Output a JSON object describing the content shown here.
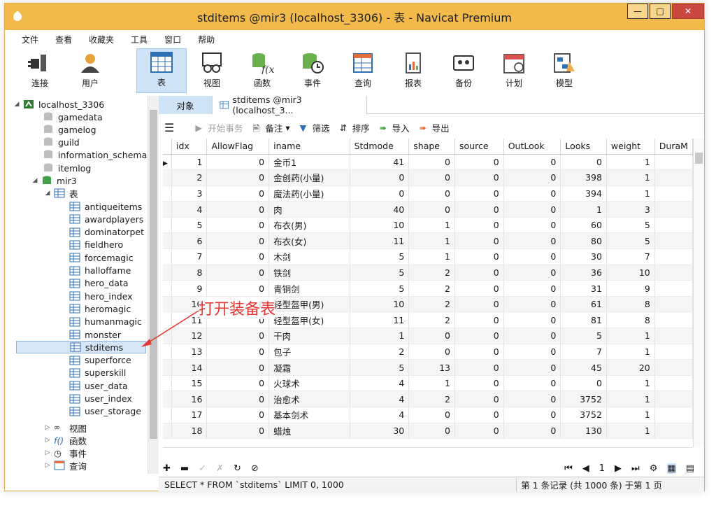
{
  "window": {
    "title": "stditems @mir3 (localhost_3306) - 表 - Navicat Premium"
  },
  "menu": [
    "文件",
    "查看",
    "收藏夹",
    "工具",
    "窗口",
    "帮助"
  ],
  "toolbar": [
    {
      "label": "连接",
      "icon": "plug-icon"
    },
    {
      "label": "用户",
      "icon": "user-icon"
    },
    {
      "label": "表",
      "icon": "table-icon",
      "active": true
    },
    {
      "label": "视图",
      "icon": "glasses-icon"
    },
    {
      "label": "函数",
      "icon": "function-icon"
    },
    {
      "label": "事件",
      "icon": "clock-db-icon"
    },
    {
      "label": "查询",
      "icon": "query-icon"
    },
    {
      "label": "报表",
      "icon": "report-icon"
    },
    {
      "label": "备份",
      "icon": "backup-icon"
    },
    {
      "label": "计划",
      "icon": "calendar-icon"
    },
    {
      "label": "模型",
      "icon": "model-icon"
    }
  ],
  "tree": {
    "connection": "localhost_3306",
    "databases": [
      "gamedata",
      "gamelog",
      "guild",
      "information_schema",
      "itemlog",
      "mir3"
    ],
    "tables_label": "表",
    "tables": [
      "antiqueitems",
      "awardplayers",
      "dominatorpet",
      "fieldhero",
      "forcemagic",
      "halloffame",
      "hero_data",
      "hero_index",
      "heromagic",
      "humanmagic",
      "monster",
      "stditems",
      "superforce",
      "superskill",
      "user_data",
      "user_index",
      "user_storage"
    ],
    "selected": "stditems",
    "other_nodes": [
      "视图",
      "函数",
      "事件",
      "查询"
    ]
  },
  "tabs": {
    "objects": "对象",
    "data": "stditems @mir3 (localhost_3..."
  },
  "grid_toolbar": {
    "begin_tx": "开始事务",
    "note": "备注",
    "filter": "筛选",
    "sort": "排序",
    "import": "导入",
    "export": "导出"
  },
  "grid": {
    "columns": [
      "idx",
      "AllowFlag",
      "iname",
      "Stdmode",
      "shape",
      "source",
      "OutLook",
      "Looks",
      "weight",
      "DuraM"
    ],
    "rows": [
      [
        "1",
        "0",
        "金币1",
        "41",
        "0",
        "0",
        "0",
        "0",
        "1"
      ],
      [
        "2",
        "0",
        "金创药(小量)",
        "0",
        "0",
        "0",
        "0",
        "398",
        "1"
      ],
      [
        "3",
        "0",
        "魔法药(小量)",
        "0",
        "0",
        "0",
        "0",
        "394",
        "1"
      ],
      [
        "4",
        "0",
        "肉",
        "40",
        "0",
        "0",
        "0",
        "1",
        "3"
      ],
      [
        "5",
        "0",
        "布衣(男)",
        "10",
        "1",
        "0",
        "0",
        "60",
        "5"
      ],
      [
        "6",
        "0",
        "布衣(女)",
        "11",
        "1",
        "0",
        "0",
        "80",
        "5"
      ],
      [
        "7",
        "0",
        "木剑",
        "5",
        "1",
        "0",
        "0",
        "30",
        "7"
      ],
      [
        "8",
        "0",
        "铁剑",
        "5",
        "2",
        "0",
        "0",
        "36",
        "10"
      ],
      [
        "9",
        "0",
        "青铜剑",
        "5",
        "2",
        "0",
        "0",
        "31",
        "9"
      ],
      [
        "10",
        "0",
        "轻型盔甲(男)",
        "10",
        "2",
        "0",
        "0",
        "61",
        "8"
      ],
      [
        "11",
        "0",
        "轻型盔甲(女)",
        "11",
        "2",
        "0",
        "0",
        "81",
        "8"
      ],
      [
        "12",
        "0",
        "干肉",
        "1",
        "0",
        "0",
        "0",
        "5",
        "1"
      ],
      [
        "13",
        "0",
        "包子",
        "2",
        "0",
        "0",
        "0",
        "7",
        "1"
      ],
      [
        "14",
        "0",
        "凝霜",
        "5",
        "13",
        "0",
        "0",
        "45",
        "20"
      ],
      [
        "15",
        "0",
        "火球术",
        "4",
        "1",
        "0",
        "0",
        "0",
        "1"
      ],
      [
        "16",
        "0",
        "治愈术",
        "4",
        "2",
        "0",
        "0",
        "3752",
        "1"
      ],
      [
        "17",
        "0",
        "基本剑术",
        "4",
        "0",
        "0",
        "0",
        "3752",
        "1"
      ],
      [
        "18",
        "0",
        "蜡烛",
        "30",
        "0",
        "0",
        "0",
        "130",
        "1"
      ]
    ]
  },
  "navigator": {
    "page": "1"
  },
  "status": {
    "sql": "SELECT * FROM `stditems` LIMIT 0, 1000",
    "records": "第 1 条记录 (共 1000 条) 于第 1 页"
  },
  "annotation": "打开装备表",
  "colors": {
    "titlebar": "#f2b94b",
    "selection": "#cfe3f7",
    "annotation": "#e53935"
  }
}
